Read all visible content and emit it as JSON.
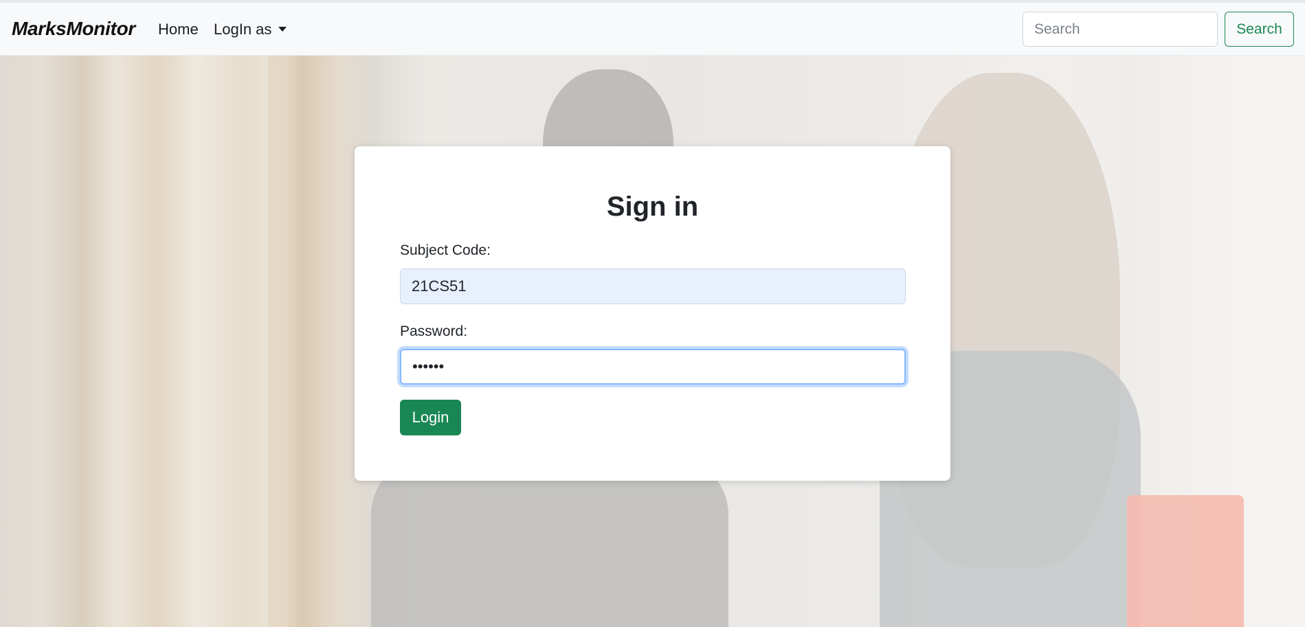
{
  "navbar": {
    "brand": "MarksMonitor",
    "home_label": "Home",
    "login_as_label": "LogIn as",
    "search_placeholder": "Search",
    "search_button_label": "Search"
  },
  "signin": {
    "title": "Sign in",
    "subject_label": "Subject Code:",
    "subject_value": "21CS51",
    "password_label": "Password:",
    "password_value": "••••••",
    "login_button_label": "Login"
  },
  "colors": {
    "primary_green": "#198754",
    "navbar_bg": "#f8f9fa",
    "autofill_bg": "#e8f0fe",
    "focus_ring": "#86b7fe"
  }
}
